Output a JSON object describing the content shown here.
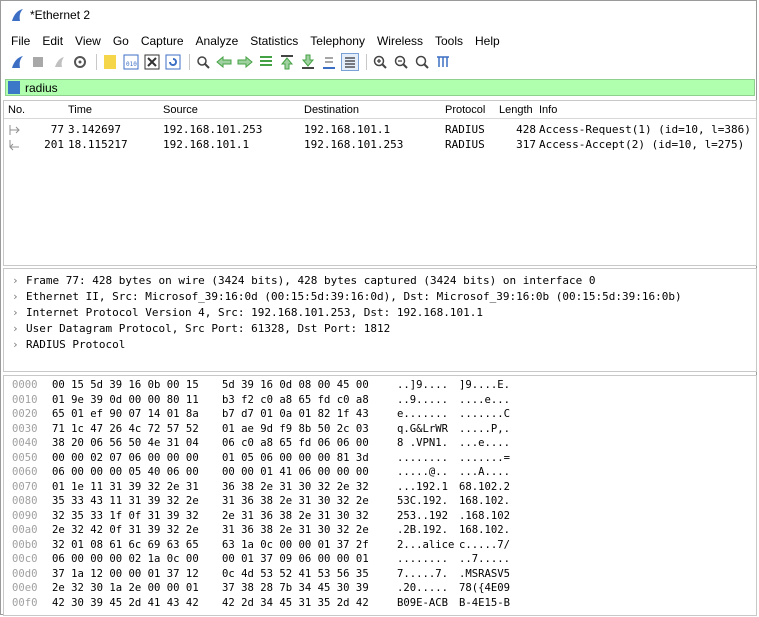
{
  "window": {
    "title": "*Ethernet 2"
  },
  "menu": [
    "File",
    "Edit",
    "View",
    "Go",
    "Capture",
    "Analyze",
    "Statistics",
    "Telephony",
    "Wireless",
    "Tools",
    "Help"
  ],
  "toolbar": {
    "icons": [
      "shark-fin-start-icon",
      "stop-icon",
      "restart-icon",
      "options-icon",
      "open-file-icon",
      "save-file-icon",
      "close-file-icon",
      "reload-icon",
      "find-icon",
      "back-icon",
      "forward-icon",
      "go-to-packet-icon",
      "first-packet-icon",
      "last-packet-icon",
      "autoscroll-icon",
      "colorize-icon",
      "zoom-in-icon",
      "zoom-out-icon",
      "zoom-reset-icon",
      "resize-columns-icon"
    ],
    "colors": {
      "blue": "#3c6fc4",
      "green": "#44a244",
      "yellow": "#f5d64a"
    }
  },
  "filter": {
    "value": "radius",
    "bg_color": "#afffaf"
  },
  "packet_list": {
    "columns": [
      "No.",
      "Time",
      "Source",
      "Destination",
      "Protocol",
      "Length",
      "Info"
    ],
    "rows": [
      {
        "no": "77",
        "time": "3.142697",
        "source": "192.168.101.253",
        "destination": "192.168.101.1",
        "protocol": "RADIUS",
        "length": "428",
        "info": "Access-Request(1) (id=10, l=386)"
      },
      {
        "no": "201",
        "time": "18.115217",
        "source": "192.168.101.1",
        "destination": "192.168.101.253",
        "protocol": "RADIUS",
        "length": "317",
        "info": "Access-Accept(2) (id=10, l=275)"
      }
    ]
  },
  "details": [
    "Frame 77: 428 bytes on wire (3424 bits), 428 bytes captured (3424 bits) on interface 0",
    "Ethernet II, Src: Microsof_39:16:0d (00:15:5d:39:16:0d), Dst: Microsof_39:16:0b (00:15:5d:39:16:0b)",
    "Internet Protocol Version 4, Src: 192.168.101.253, Dst: 192.168.101.1",
    "User Datagram Protocol, Src Port: 61328, Dst Port: 1812",
    "RADIUS Protocol"
  ],
  "bytes": [
    {
      "offset": "0000",
      "hex1": "00 15 5d 39 16 0b 00 15",
      "hex2": "5d 39 16 0d 08 00 45 00",
      "ascii1": "..]9....",
      "ascii2": "]9....E."
    },
    {
      "offset": "0010",
      "hex1": "01 9e 39 0d 00 00 80 11",
      "hex2": "b3 f2 c0 a8 65 fd c0 a8",
      "ascii1": "..9.....",
      "ascii2": "....e..."
    },
    {
      "offset": "0020",
      "hex1": "65 01 ef 90 07 14 01 8a",
      "hex2": "b7 d7 01 0a 01 82 1f 43",
      "ascii1": "e.......",
      "ascii2": ".......C"
    },
    {
      "offset": "0030",
      "hex1": "71 1c 47 26 4c 72 57 52",
      "hex2": "01 ae 9d f9 8b 50 2c 03",
      "ascii1": "q.G&LrWR",
      "ascii2": ".....P,."
    },
    {
      "offset": "0040",
      "hex1": "38 20 06 56 50 4e 31 04",
      "hex2": "06 c0 a8 65 fd 06 06 00",
      "ascii1": "8 .VPN1.",
      "ascii2": "...e...."
    },
    {
      "offset": "0050",
      "hex1": "00 00 02 07 06 00 00 00",
      "hex2": "01 05 06 00 00 00 81 3d",
      "ascii1": "........",
      "ascii2": ".......="
    },
    {
      "offset": "0060",
      "hex1": "06 00 00 00 05 40 06 00",
      "hex2": "00 00 01 41 06 00 00 00",
      "ascii1": ".....@..",
      "ascii2": "...A...."
    },
    {
      "offset": "0070",
      "hex1": "01 1e 11 31 39 32 2e 31",
      "hex2": "36 38 2e 31 30 32 2e 32",
      "ascii1": "...192.1",
      "ascii2": "68.102.2"
    },
    {
      "offset": "0080",
      "hex1": "35 33 43 11 31 39 32 2e",
      "hex2": "31 36 38 2e 31 30 32 2e",
      "ascii1": "53C.192.",
      "ascii2": "168.102."
    },
    {
      "offset": "0090",
      "hex1": "32 35 33 1f 0f 31 39 32",
      "hex2": "2e 31 36 38 2e 31 30 32",
      "ascii1": "253..192",
      "ascii2": ".168.102"
    },
    {
      "offset": "00a0",
      "hex1": "2e 32 42 0f 31 39 32 2e",
      "hex2": "31 36 38 2e 31 30 32 2e",
      "ascii1": ".2B.192.",
      "ascii2": "168.102."
    },
    {
      "offset": "00b0",
      "hex1": "32 01 08 61 6c 69 63 65",
      "hex2": "63 1a 0c 00 00 01 37 2f",
      "ascii1": "2...alice",
      "ascii2": "c.....7/"
    },
    {
      "offset": "00c0",
      "hex1": "06 00 00 00 02 1a 0c 00",
      "hex2": "00 01 37 09 06 00 00 01",
      "ascii1": "........",
      "ascii2": "..7....."
    },
    {
      "offset": "00d0",
      "hex1": "37 1a 12 00 00 01 37 12",
      "hex2": "0c 4d 53 52 41 53 56 35",
      "ascii1": "7.....7.",
      "ascii2": ".MSRASV5"
    },
    {
      "offset": "00e0",
      "hex1": "2e 32 30 1a 2e 00 00 01",
      "hex2": "37 38 28 7b 34 45 30 39",
      "ascii1": ".20.....",
      "ascii2": "78({4E09"
    },
    {
      "offset": "00f0",
      "hex1": "42 30 39 45 2d 41 43 42",
      "hex2": "42 2d 34 45 31 35 2d 42",
      "ascii1": "B09E-ACB",
      "ascii2": "B-4E15-B"
    }
  ]
}
